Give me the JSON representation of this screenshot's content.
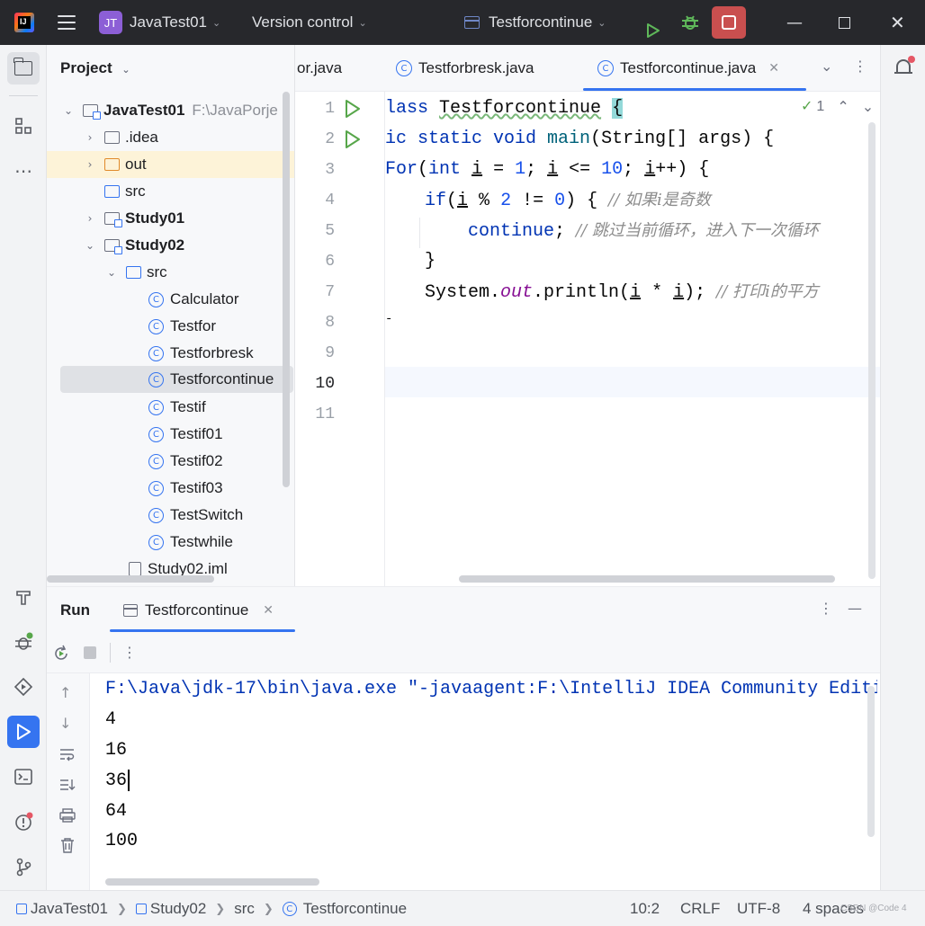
{
  "titlebar": {
    "project_badge": "JT",
    "project_name": "JavaTest01",
    "vcs": "Version control",
    "run_config": "Testforcontinue",
    "icons": [
      "intellij-logo",
      "main-menu-icon",
      "run-icon",
      "debug-icon",
      "stop-icon",
      "minimize-icon",
      "maximize-icon",
      "close-icon"
    ]
  },
  "project_panel": {
    "title": "Project",
    "tree": [
      {
        "label": "JavaTest01",
        "path": "F:\\JavaPorje",
        "kind": "module",
        "bold": true
      },
      {
        "label": ".idea",
        "kind": "folder"
      },
      {
        "label": "out",
        "kind": "folder-excluded"
      },
      {
        "label": "src",
        "kind": "source-folder"
      },
      {
        "label": "Study01",
        "kind": "module",
        "bold": true
      },
      {
        "label": "Study02",
        "kind": "module",
        "bold": true
      },
      {
        "label": "src",
        "kind": "source-folder"
      },
      {
        "label": "Calculator",
        "kind": "class"
      },
      {
        "label": "Testfor",
        "kind": "class"
      },
      {
        "label": "Testforbresk",
        "kind": "class"
      },
      {
        "label": "Testforcontinue",
        "kind": "class",
        "selected": true
      },
      {
        "label": "Testif",
        "kind": "class"
      },
      {
        "label": "Testif01",
        "kind": "class"
      },
      {
        "label": "Testif02",
        "kind": "class"
      },
      {
        "label": "Testif03",
        "kind": "class"
      },
      {
        "label": "TestSwitch",
        "kind": "class"
      },
      {
        "label": "Testwhile",
        "kind": "class"
      },
      {
        "label": "Study02.iml",
        "kind": "file"
      }
    ]
  },
  "editor": {
    "tabs": [
      {
        "label": "or.java"
      },
      {
        "label": "Testforbresk.java"
      },
      {
        "label": "Testforcontinue.java",
        "active": true
      }
    ],
    "inspection_count": "1",
    "line_numbers": [
      "1",
      "2",
      "3",
      "4",
      "5",
      "6",
      "7",
      "8",
      "9",
      "10",
      "11"
    ],
    "current_line": "10",
    "code": {
      "l1_kw": "lass",
      "l1_name": "Testforcontinue",
      "l1_brace": "{",
      "l2_kw": "ic static void",
      "l2_fn": "main",
      "l2_rest": "(String[] args) {",
      "l3_kw1": "For",
      "l3_a": "(",
      "l3_kw2": "int",
      "l3_v1": "i",
      "l3_b": " = ",
      "l3_n1": "1",
      "l3_c": "; ",
      "l3_v2": "i",
      "l3_d": " <= ",
      "l3_n2": "10",
      "l3_e": "; ",
      "l3_v3": "i",
      "l3_f": "++) {",
      "l4_kw": "if",
      "l4_a": "(",
      "l4_v": "i",
      "l4_b": " % ",
      "l4_n1": "2",
      "l4_c": " != ",
      "l4_n2": "0",
      "l4_d": ") { ",
      "l4_cm": "// 如果i是奇数",
      "l5_kw": "continue",
      "l5_a": "; ",
      "l5_cm": "// 跳过当前循环，进入下一次循环",
      "l6": "}",
      "l7_a": "System.",
      "l7_fld": "out",
      "l7_b": ".println(",
      "l7_v1": "i",
      "l7_c": " * ",
      "l7_v2": "i",
      "l7_d": "); ",
      "l7_cm": "// 打印i的平方",
      "l8": "-"
    }
  },
  "run_panel": {
    "title": "Run",
    "tab": "Testforcontinue",
    "command": "F:\\Java\\jdk-17\\bin\\java.exe \"-javaagent:F:\\IntelliJ IDEA Community Editi",
    "output": [
      "4",
      "16",
      "36",
      "64",
      "100"
    ]
  },
  "status_bar": {
    "breadcrumb": [
      "JavaTest01",
      "Study02",
      "src",
      "Testforcontinue"
    ],
    "position": "10:2",
    "line_sep": "CRLF",
    "encoding": "UTF-8",
    "indent": "4 spaces",
    "watermark": "CSDN @Code 4"
  },
  "colors": {
    "accent": "#3574f0",
    "run_green": "#57a64a",
    "stop_red": "#c94f4f",
    "titlebar_bg": "#27282c"
  }
}
